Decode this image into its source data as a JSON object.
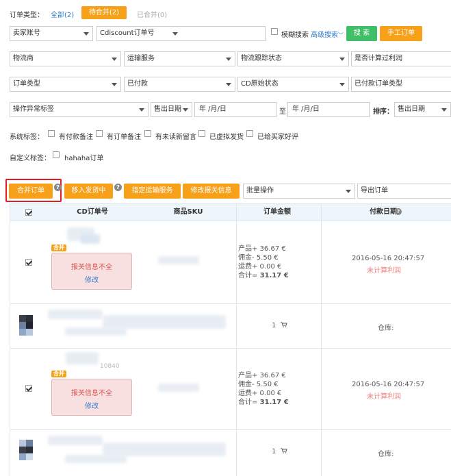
{
  "filters": {
    "order_type_label": "订单类型：",
    "tabs": [
      {
        "label": "全部(2)"
      },
      {
        "label": "待合并(2)"
      },
      {
        "label": "已合并(0)"
      }
    ],
    "seller_account": "卖家账号",
    "cd_order_no": "Cdiscount订单号",
    "fuzzy_search": "模糊搜索",
    "advanced_search": "高级搜索",
    "search_btn": "搜 索",
    "manual_order_btn": "手工订单",
    "logistics": "物流商",
    "shipping_service": "运输服务",
    "tracking_status": "物流跟踪状态",
    "profit_calculated": "是否计算过利润",
    "order_type_select": "订单类型",
    "payment_status": "已付款",
    "cd_raw_status": "CD原始状态",
    "paid_order_type": "已付款订单类型",
    "abnormal_tag": "操作异常标签",
    "date_type": "售出日期",
    "date_from": " 年 /月/日",
    "date_to_sep": "至",
    "date_to": " 年 /月/日",
    "sort_label": "排序：",
    "sort_value": "售出日期",
    "system_tags_label": "系统标签：",
    "system_tags": [
      "有付款备注",
      "有订单备注",
      "有未读新留言",
      "已虚拟发货",
      "已给买家好评"
    ],
    "custom_tags_label": "自定义标签：",
    "custom_tags": [
      "hahaha订单"
    ]
  },
  "actions": {
    "merge_btn": "合并订单",
    "move_shipping_btn": "移入发货中",
    "assign_shipping_btn": "指定运输服务",
    "modify_customs_btn": "修改报关信息",
    "batch_ops": "批量操作",
    "export_orders": "导出订单"
  },
  "table": {
    "headers": {
      "cd_order_no": "CD订单号",
      "sku": "商品SKU",
      "amount": "订单金额",
      "pay_date": "付款日期"
    },
    "rows": [
      {
        "badge": "合并",
        "customs_msg": "报关信息不全",
        "customs_edit": "修改",
        "product": "产品+ 36.67 €",
        "commission": "佣金-  5.50 €",
        "freight": "运费+ 0.00 €",
        "total_label": "合计=",
        "total_value": "31.17 €",
        "pay_date": "2016-05-16 20:47:57",
        "profit_status": "未计算利润",
        "qty": "1",
        "warehouse": "仓库:"
      },
      {
        "badge": "合并",
        "id_fragment": "10840",
        "customs_msg": "报关信息不全",
        "customs_edit": "修改",
        "product": "产品+ 36.67 €",
        "commission": "佣金-  5.50 €",
        "freight": "运费+ 0.00 €",
        "total_label": "合计=",
        "total_value": "31.17 €",
        "pay_date": "2016-05-16 20:47:57",
        "profit_status": "未计算利润",
        "qty": "1",
        "warehouse": "仓库:"
      }
    ]
  },
  "colors": {
    "orange": "#f7a11a",
    "green": "#3fbf68",
    "link_blue": "#2e7bc9",
    "highlight_red": "#e02020",
    "header_bg": "#eef5fb"
  }
}
